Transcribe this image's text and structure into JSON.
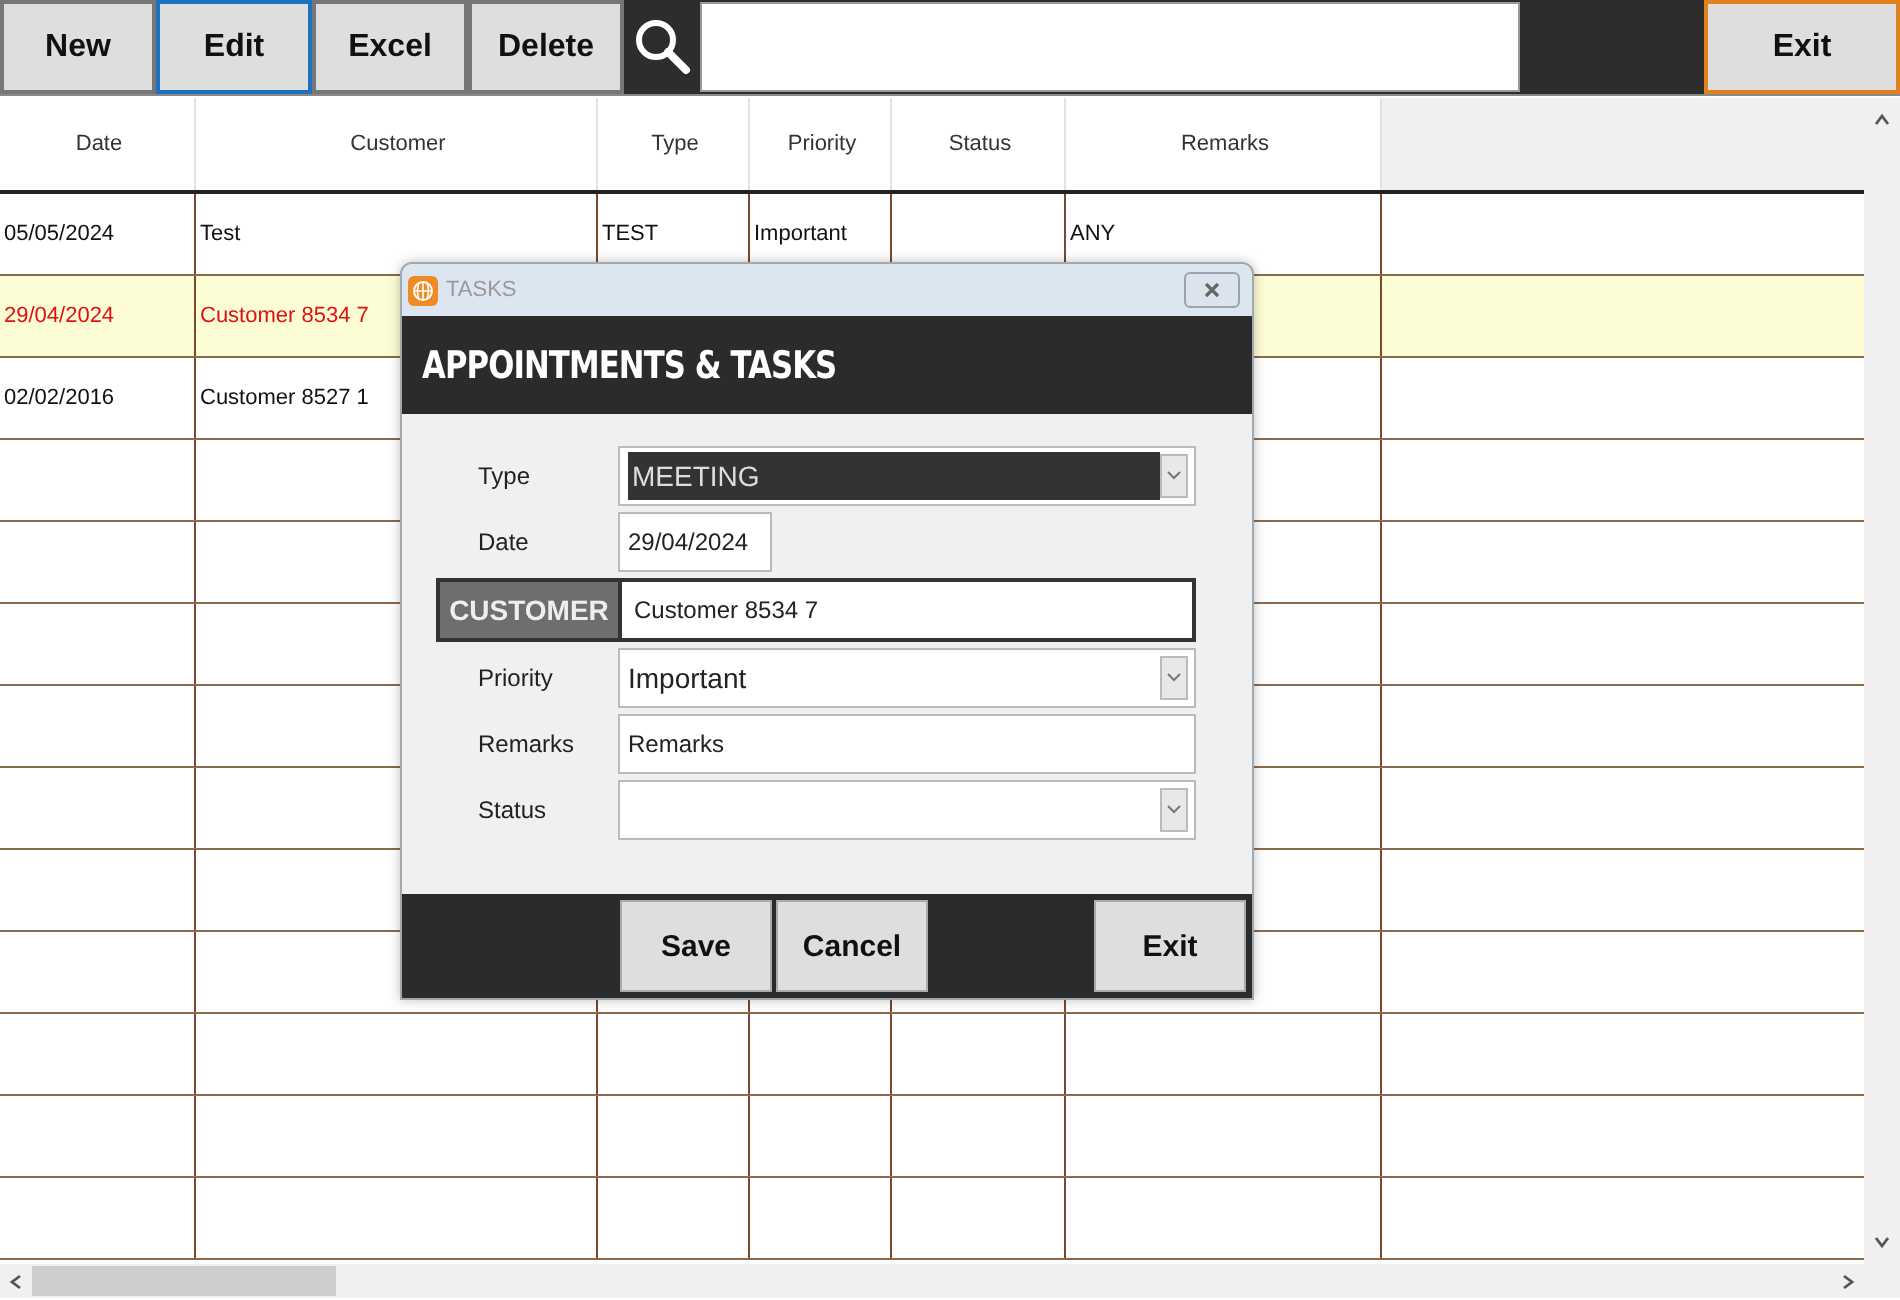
{
  "toolbar": {
    "buttons": [
      {
        "label": "New",
        "selected": false
      },
      {
        "label": "Edit",
        "selected": true
      },
      {
        "label": "Excel",
        "selected": false
      },
      {
        "label": "Delete",
        "selected": false
      }
    ],
    "exit": {
      "label": "Exit",
      "selected": true
    }
  },
  "table": {
    "columns": [
      "Date",
      "Customer",
      "Type",
      "Priority",
      "Status",
      "Remarks"
    ],
    "rows": [
      {
        "selected": false,
        "cells": [
          "05/05/2024",
          "Test",
          "TEST",
          "Important",
          "",
          "ANY"
        ]
      },
      {
        "selected": true,
        "cells": [
          "29/04/2024",
          "Customer 8534 7"
        ]
      },
      {
        "selected": false,
        "cells": [
          "02/02/2016",
          "Customer 8527 1"
        ]
      }
    ]
  },
  "dialog": {
    "title": "TASKS",
    "heading": "APPOINTMENTS & TASKS",
    "fields": [
      {
        "kind": "select",
        "label": "Type",
        "value": "MEETING",
        "highlighted": true
      },
      {
        "kind": "date",
        "label": "Date",
        "value": "29/04/2024"
      },
      {
        "kind": "customer",
        "label": "CUSTOMER",
        "value": "Customer 8534 7"
      },
      {
        "kind": "select",
        "label": "Priority",
        "value": "Important",
        "highlighted": false
      },
      {
        "kind": "text",
        "label": "Remarks",
        "value": "Remarks"
      },
      {
        "kind": "select",
        "label": "Status",
        "highlighted": false
      }
    ],
    "buttons": [
      {
        "label": "Save",
        "kind": "left"
      },
      {
        "label": "Cancel",
        "kind": "left"
      },
      {
        "label": "Exit",
        "kind": "right"
      }
    ]
  }
}
